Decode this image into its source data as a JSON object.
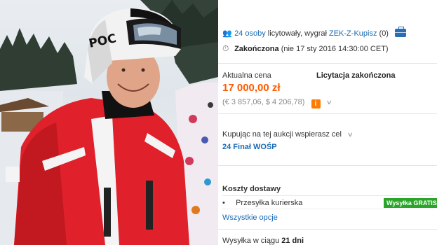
{
  "photo": {
    "helmet_logo": "POC",
    "alt_icon": "skier-photo"
  },
  "bidders": {
    "count_link": "24 osoby",
    "text": "licytowały, wygrał",
    "winner": "ZEK-Z-Kupisz",
    "score": "(0)",
    "icon": "people-icon",
    "badge_icon": "briefcase-icon"
  },
  "ended": {
    "status": "Zakończona",
    "date": "(nie 17 sty 2016 14:30:00 CET)",
    "icon": "clock-icon"
  },
  "price": {
    "label": "Aktualna cena",
    "auction_status": "Licytacja zakończona",
    "amount": "17 000,00 zł",
    "conversions": "(€ 3 857,06, $ 4 206,78)"
  },
  "charity": {
    "text": "Kupując na tej aukcji wspierasz cel",
    "name": "24 Finał WOŚP"
  },
  "shipping": {
    "header": "Koszty dostawy",
    "method": "Przesyłka kurierska",
    "badge": "Wysyłka GRATIS",
    "all_options": "Wszystkie opcje",
    "dispatch_prefix": "Wysyłka w ciągu",
    "dispatch_days": "21 dni"
  },
  "colors": {
    "price": "#ff5a00",
    "link": "#1b6bb5",
    "badge_bg": "#2aa52a",
    "jacket": "#e0202a"
  }
}
